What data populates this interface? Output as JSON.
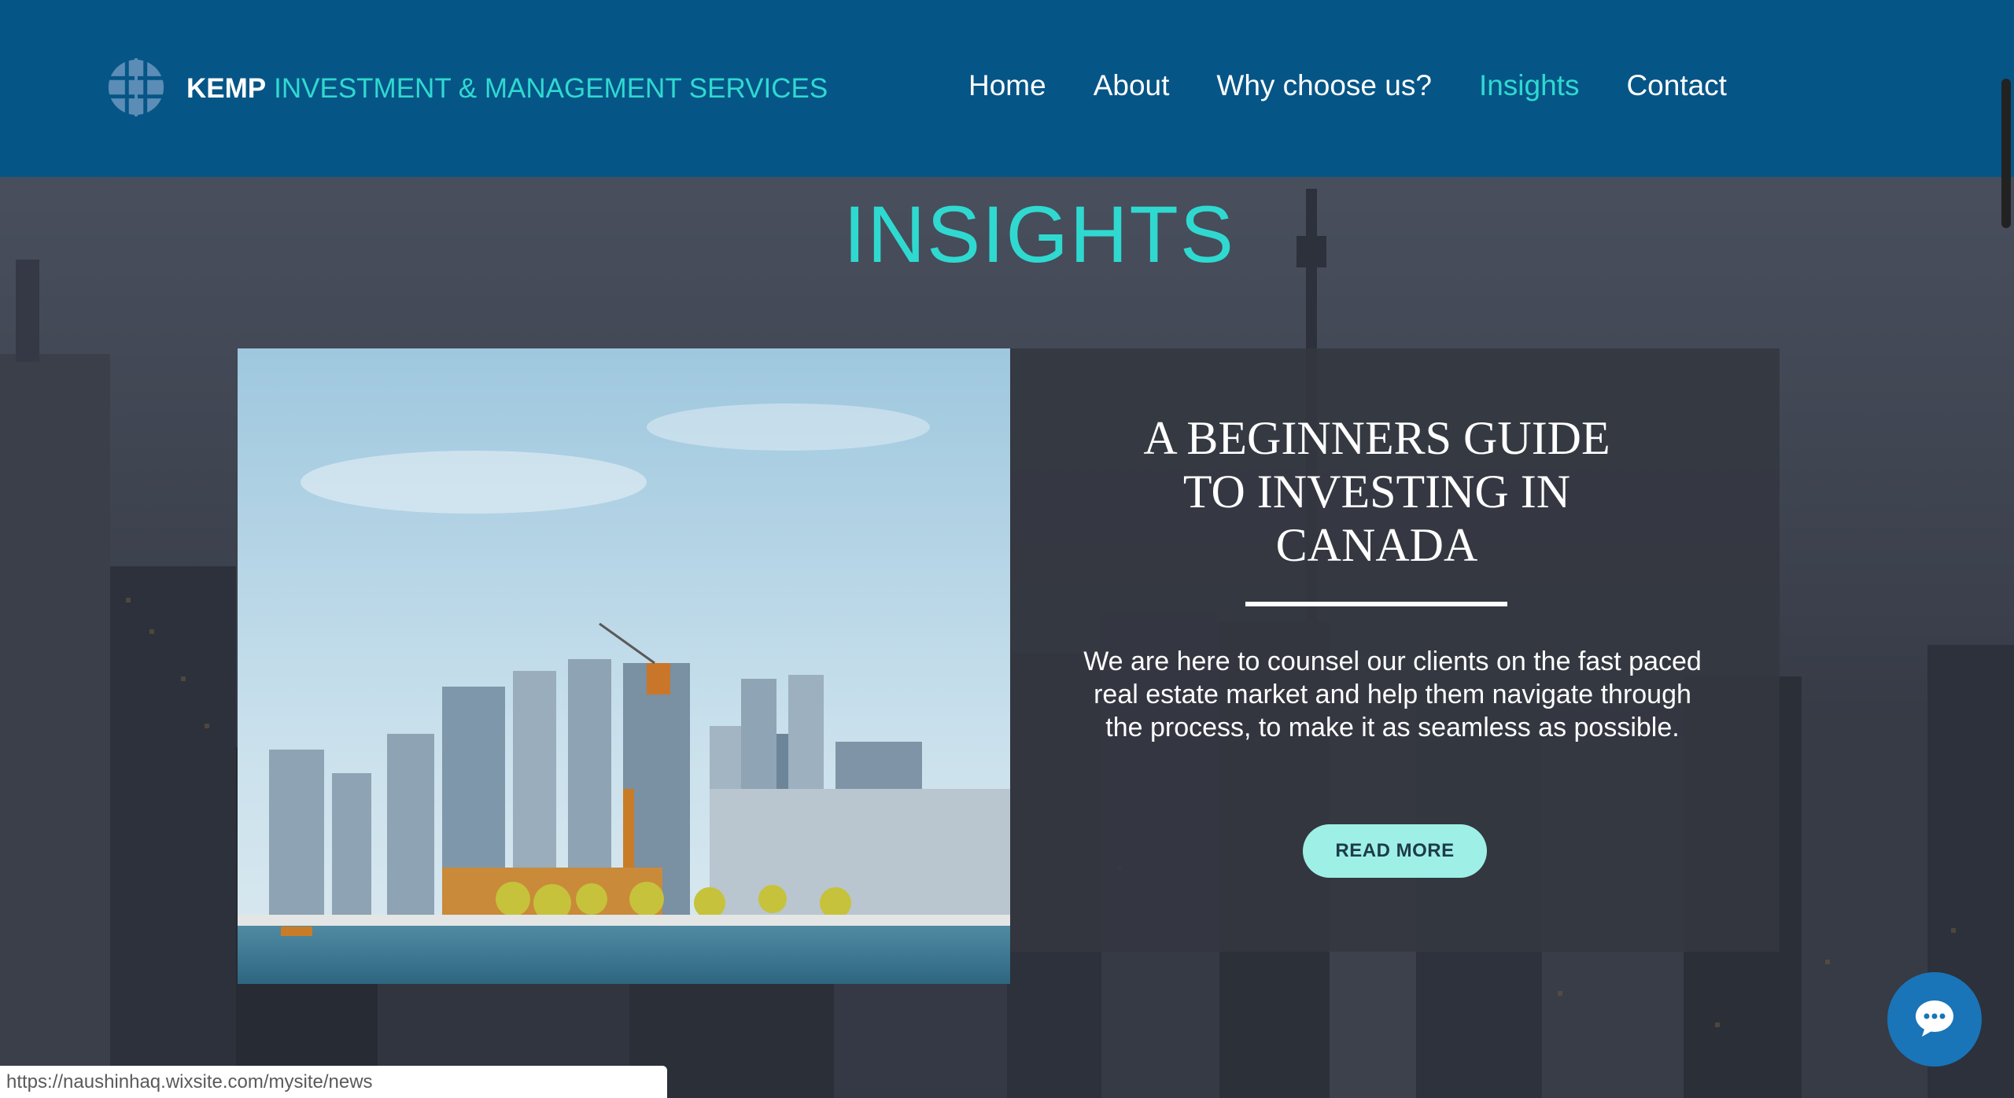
{
  "header": {
    "brand_strong": "KEMP",
    "brand_rest": "INVESTMENT & MANAGEMENT SERVICES",
    "nav": [
      {
        "label": "Home"
      },
      {
        "label": "About"
      },
      {
        "label": "Why choose us?"
      },
      {
        "label": "Insights"
      },
      {
        "label": "Contact"
      }
    ]
  },
  "main": {
    "section_title": "INSIGHTS",
    "card": {
      "title_lines": [
        "A BEGINNERS GUIDE",
        "TO INVESTING IN",
        "CANADA"
      ],
      "body": "We are here to counsel our clients on the fast paced real estate market and help them navigate through the process, to make it as seamless as possible.",
      "button_label": "READ MORE",
      "image_icon": "toronto-waterfront-photo"
    }
  },
  "chat": {
    "icon": "chat-bubble-icon"
  },
  "status_bar": {
    "url": "https://naushinhaq.wixsite.com/mysite/news"
  },
  "colors": {
    "header_bg": "#065587",
    "accent": "#2fd9d0",
    "button_bg": "#9ef0e6",
    "chat_bg": "#1975b8"
  }
}
